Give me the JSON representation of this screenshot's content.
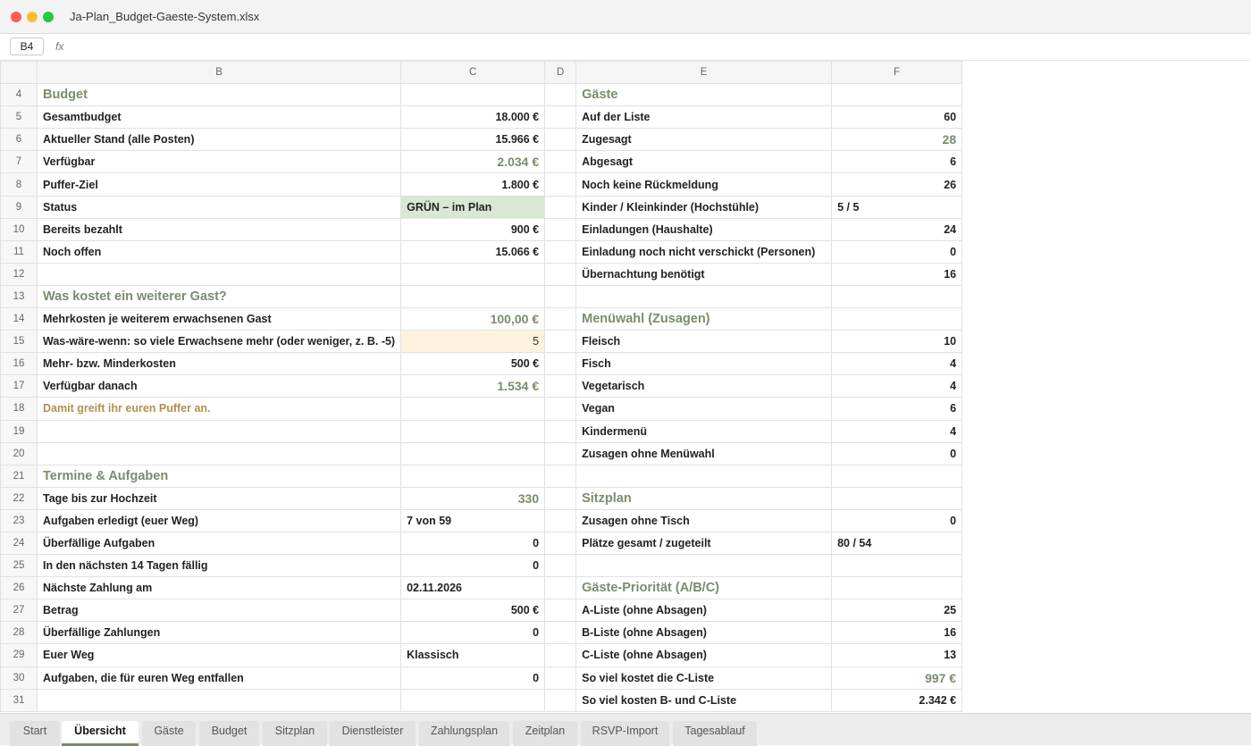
{
  "window": {
    "title": "Ja-Plan_Budget-Gaeste-System.xlsx"
  },
  "formula_bar": {
    "cell_ref": "B4",
    "fx_label": "fx",
    "value": ""
  },
  "columns": [
    "B",
    "C",
    "D",
    "E",
    "F"
  ],
  "rows": [
    {
      "num": "4",
      "b": "Budget",
      "b_style": "sec",
      "c": "",
      "c_style": "",
      "e": "Gäste",
      "e_style": "sec",
      "f": "",
      "f_style": ""
    },
    {
      "num": "5",
      "b": "Gesamtbudget",
      "b_style": "lbl",
      "c": "18.000 €",
      "c_style": "num",
      "e": "Auf der Liste",
      "e_style": "lbl",
      "f": "60",
      "f_style": "num"
    },
    {
      "num": "6",
      "b": "Aktueller Stand (alle Posten)",
      "b_style": "lbl",
      "c": "15.966 €",
      "c_style": "num",
      "e": "Zugesagt",
      "e_style": "lbl",
      "f": "28",
      "f_style": "big"
    },
    {
      "num": "7",
      "b": "Verfügbar",
      "b_style": "lbl",
      "c": "2.034 €",
      "c_style": "big",
      "e": "Abgesagt",
      "e_style": "lbl",
      "f": "6",
      "f_style": "num"
    },
    {
      "num": "8",
      "b": "Puffer-Ziel",
      "b_style": "lbl",
      "c": "1.800 €",
      "c_style": "num",
      "e": "Noch keine Rückmeldung",
      "e_style": "lbl",
      "f": "26",
      "f_style": "num"
    },
    {
      "num": "9",
      "b": "Status",
      "b_style": "lbl",
      "c": "GRÜN – im Plan",
      "c_style": "status",
      "e": "Kinder / Kleinkinder (Hochstühle)",
      "e_style": "lbl",
      "f": "5 / 5",
      "f_style": "txt"
    },
    {
      "num": "10",
      "b": "Bereits bezahlt",
      "b_style": "lbl",
      "c": "900 €",
      "c_style": "num",
      "e": "Einladungen (Haushalte)",
      "e_style": "lbl",
      "f": "24",
      "f_style": "num"
    },
    {
      "num": "11",
      "b": "Noch offen",
      "b_style": "lbl",
      "c": "15.066 €",
      "c_style": "num",
      "e": "Einladung noch nicht verschickt (Personen)",
      "e_style": "lbl",
      "f": "0",
      "f_style": "num"
    },
    {
      "num": "12",
      "b": "",
      "b_style": "",
      "c": "",
      "c_style": "",
      "e": "Übernachtung benötigt",
      "e_style": "lbl",
      "f": "16",
      "f_style": "num"
    },
    {
      "num": "13",
      "b": "Was kostet ein weiterer Gast?",
      "b_style": "sec",
      "c": "",
      "c_style": "",
      "e": "",
      "e_style": "",
      "f": "",
      "f_style": ""
    },
    {
      "num": "14",
      "b": "Mehrkosten je weiterem erwachsenen Gast",
      "b_style": "lbl",
      "c": "100,00 €",
      "c_style": "big",
      "e": "Menüwahl (Zusagen)",
      "e_style": "sec",
      "f": "",
      "f_style": ""
    },
    {
      "num": "15",
      "b": "Was-wäre-wenn: so viele Erwachsene mehr (oder weniger, z. B. -5)",
      "b_style": "lbl",
      "c": "5",
      "c_style": "inputcell",
      "e": "Fleisch",
      "e_style": "lbl",
      "f": "10",
      "f_style": "num"
    },
    {
      "num": "16",
      "b": "Mehr- bzw. Minderkosten",
      "b_style": "lbl",
      "c": "500 €",
      "c_style": "num",
      "e": "Fisch",
      "e_style": "lbl",
      "f": "4",
      "f_style": "num"
    },
    {
      "num": "17",
      "b": "Verfügbar danach",
      "b_style": "lbl",
      "c": "1.534 €",
      "c_style": "big",
      "e": "Vegetarisch",
      "e_style": "lbl",
      "f": "4",
      "f_style": "num"
    },
    {
      "num": "18",
      "b": "Damit greift ihr euren Puffer an.",
      "b_style": "warn",
      "c": "",
      "c_style": "",
      "e": "Vegan",
      "e_style": "lbl",
      "f": "6",
      "f_style": "num"
    },
    {
      "num": "19",
      "b": "",
      "b_style": "",
      "c": "",
      "c_style": "",
      "e": "Kindermenü",
      "e_style": "lbl",
      "f": "4",
      "f_style": "num"
    },
    {
      "num": "20",
      "b": "",
      "b_style": "",
      "c": "",
      "c_style": "",
      "e": "Zusagen ohne Menüwahl",
      "e_style": "lbl",
      "f": "0",
      "f_style": "num"
    },
    {
      "num": "21",
      "b": "Termine & Aufgaben",
      "b_style": "sec",
      "c": "",
      "c_style": "",
      "e": "",
      "e_style": "",
      "f": "",
      "f_style": ""
    },
    {
      "num": "22",
      "b": "Tage bis zur Hochzeit",
      "b_style": "lbl",
      "c": "330",
      "c_style": "big",
      "e": "Sitzplan",
      "e_style": "sec",
      "f": "",
      "f_style": ""
    },
    {
      "num": "23",
      "b": "Aufgaben erledigt (euer Weg)",
      "b_style": "lbl",
      "c": "7 von 59",
      "c_style": "txt",
      "e": "Zusagen ohne Tisch",
      "e_style": "lbl",
      "f": "0",
      "f_style": "num"
    },
    {
      "num": "24",
      "b": "Überfällige Aufgaben",
      "b_style": "lbl",
      "c": "0",
      "c_style": "num",
      "e": "Plätze gesamt / zugeteilt",
      "e_style": "lbl",
      "f": "80 / 54",
      "f_style": "txt"
    },
    {
      "num": "25",
      "b": "In den nächsten 14 Tagen fällig",
      "b_style": "lbl",
      "c": "0",
      "c_style": "num",
      "e": "",
      "e_style": "",
      "f": "",
      "f_style": ""
    },
    {
      "num": "26",
      "b": "Nächste Zahlung am",
      "b_style": "lbl",
      "c": "02.11.2026",
      "c_style": "txt",
      "e": "Gäste-Priorität (A/B/C)",
      "e_style": "sec",
      "f": "",
      "f_style": ""
    },
    {
      "num": "27",
      "b": "Betrag",
      "b_style": "lbl",
      "c": "500 €",
      "c_style": "num",
      "e": "A-Liste (ohne Absagen)",
      "e_style": "lbl",
      "f": "25",
      "f_style": "num"
    },
    {
      "num": "28",
      "b": "Überfällige Zahlungen",
      "b_style": "lbl",
      "c": "0",
      "c_style": "num",
      "e": "B-Liste (ohne Absagen)",
      "e_style": "lbl",
      "f": "16",
      "f_style": "num"
    },
    {
      "num": "29",
      "b": "Euer Weg",
      "b_style": "lbl",
      "c": "Klassisch",
      "c_style": "txt",
      "e": "C-Liste (ohne Absagen)",
      "e_style": "lbl",
      "f": "13",
      "f_style": "num"
    },
    {
      "num": "30",
      "b": "Aufgaben, die für euren Weg entfallen",
      "b_style": "lbl",
      "c": "0",
      "c_style": "num",
      "e": "So viel kostet die C-Liste",
      "e_style": "lbl",
      "f": "997 €",
      "f_style": "big"
    },
    {
      "num": "31",
      "b": "",
      "b_style": "",
      "c": "",
      "c_style": "",
      "e": "So viel kosten B- und C-Liste",
      "e_style": "lbl",
      "f": "2.342 €",
      "f_style": "num"
    }
  ],
  "tabs": [
    {
      "label": "Start",
      "active": false
    },
    {
      "label": "Übersicht",
      "active": true
    },
    {
      "label": "Gäste",
      "active": false
    },
    {
      "label": "Budget",
      "active": false
    },
    {
      "label": "Sitzplan",
      "active": false
    },
    {
      "label": "Dienstleister",
      "active": false
    },
    {
      "label": "Zahlungsplan",
      "active": false
    },
    {
      "label": "Zeitplan",
      "active": false
    },
    {
      "label": "RSVP-Import",
      "active": false
    },
    {
      "label": "Tagesablauf",
      "active": false
    }
  ]
}
